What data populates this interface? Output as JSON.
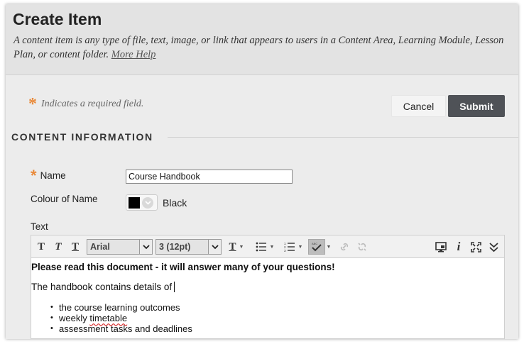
{
  "page": {
    "title": "Create Item",
    "description": "A content item is any type of file, text, image, or link that appears to users in a Content Area, Learning Module, Lesson Plan, or content folder.",
    "help_link": "More Help"
  },
  "form": {
    "required_note": "Indicates a required field.",
    "cancel_label": "Cancel",
    "submit_label": "Submit",
    "section_title": "CONTENT INFORMATION",
    "name_label": "Name",
    "name_value": "Course Handbook",
    "colour_label": "Colour of Name",
    "colour_value": "Black",
    "colour_swatch": "#000000",
    "text_label": "Text"
  },
  "toolbar": {
    "bold_glyph": "T",
    "italic_glyph": "T",
    "underline_glyph": "T",
    "font_family": "Arial",
    "font_size": "3 (12pt)",
    "icons": [
      "bold-icon",
      "italic-icon",
      "underline-icon",
      "font-color-icon",
      "bullet-list-icon",
      "numbered-list-icon",
      "spellcheck-icon",
      "link-icon",
      "unlink-icon",
      "preview-icon",
      "info-icon",
      "fullscreen-icon",
      "collapse-icon"
    ]
  },
  "editor": {
    "bold_line": "Please read this document - it will answer many of your questions!",
    "plain_line": "The handbook contains details of",
    "bullets": [
      "the course learning outcomes",
      "weekly timetable",
      "assessment tasks and deadlines"
    ]
  },
  "colors": {
    "accent_star": "#e98a3a",
    "submit_bg": "#4f5257"
  }
}
